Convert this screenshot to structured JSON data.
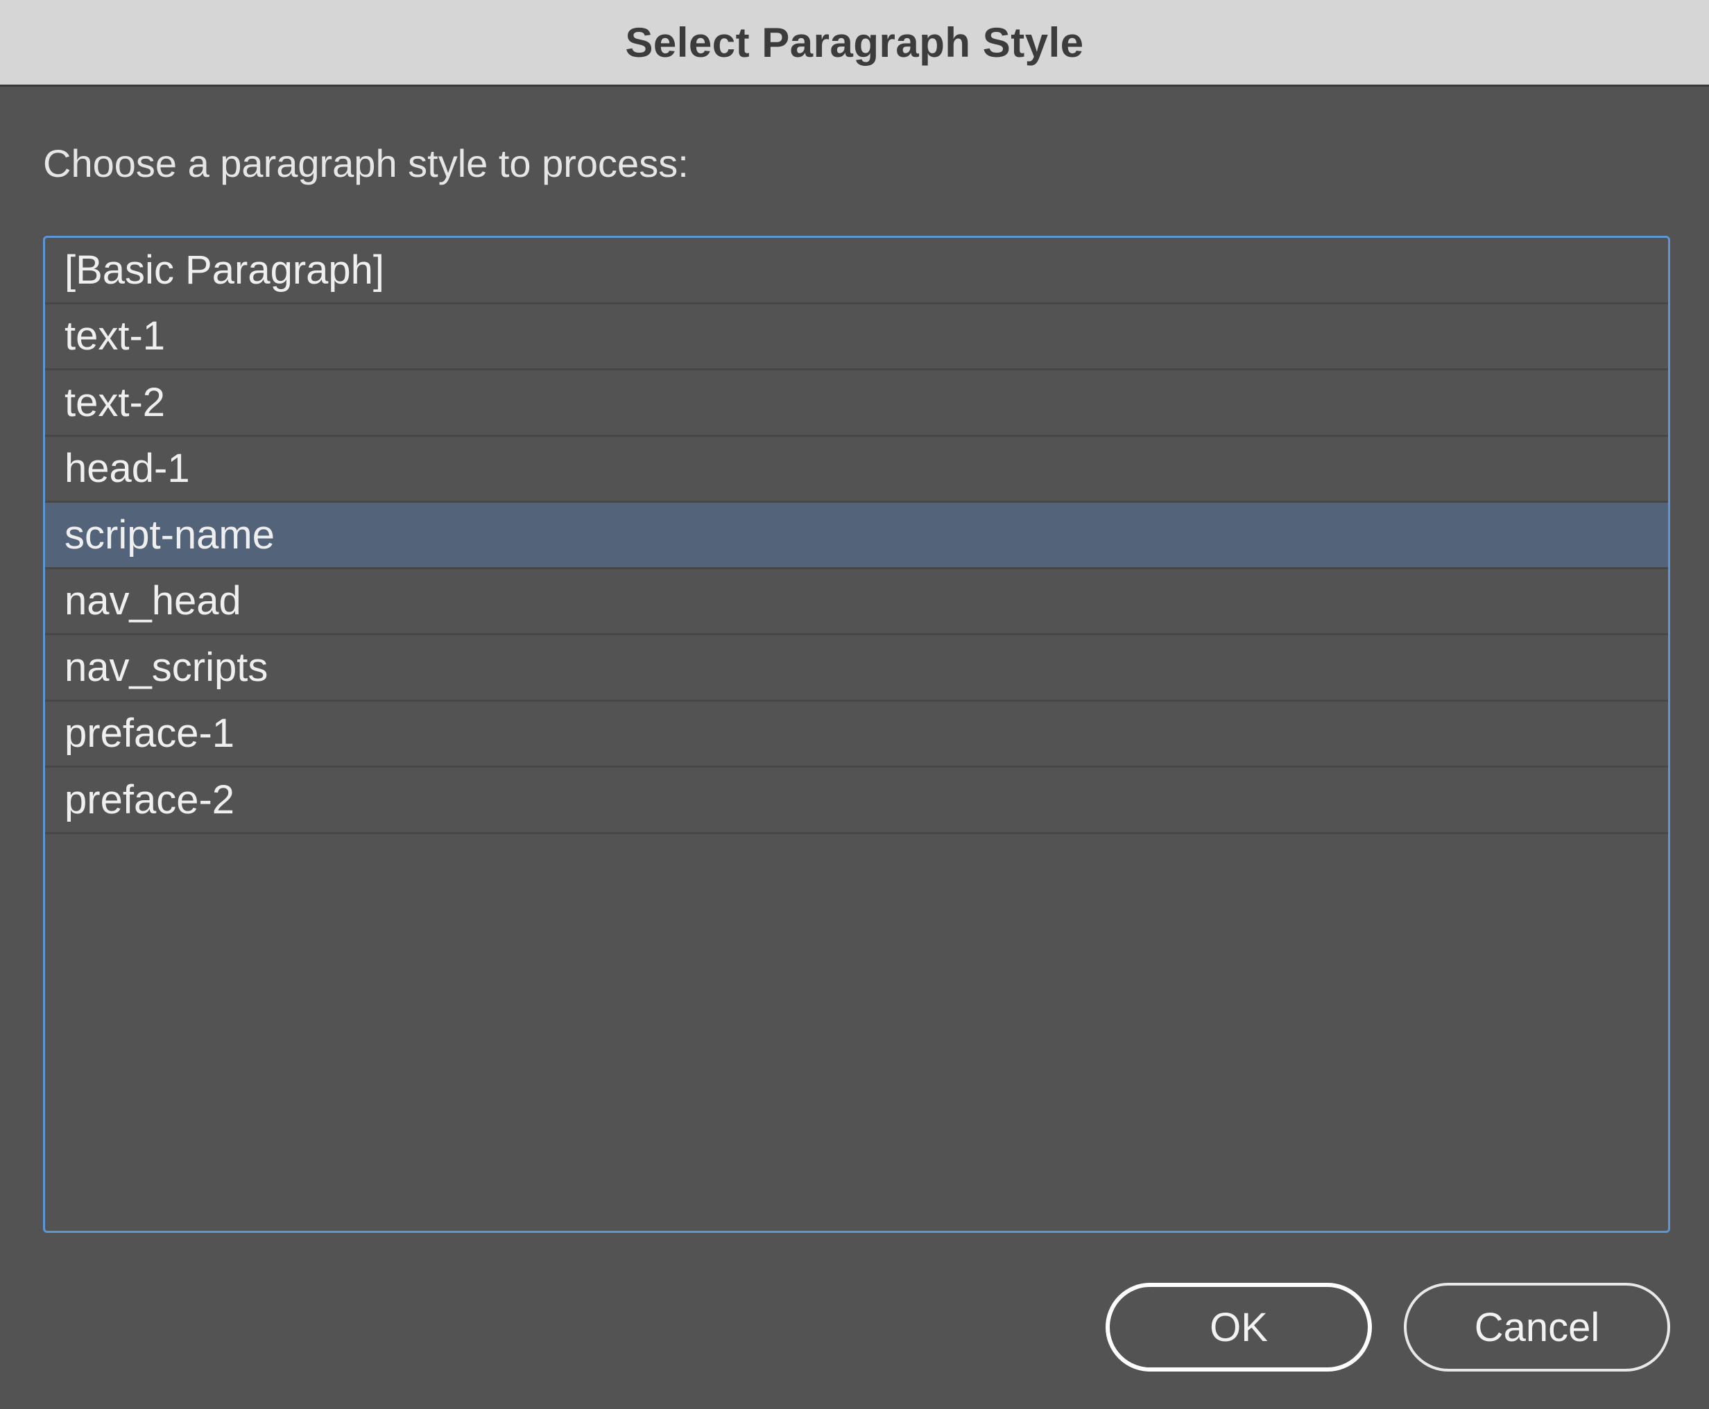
{
  "window": {
    "title": "Select Paragraph Style"
  },
  "prompt": "Choose a paragraph style to process:",
  "list": {
    "items": [
      {
        "label": "[Basic Paragraph]",
        "selected": false
      },
      {
        "label": "text-1",
        "selected": false
      },
      {
        "label": "text-2",
        "selected": false
      },
      {
        "label": "head-1",
        "selected": false
      },
      {
        "label": "script-name",
        "selected": true
      },
      {
        "label": "nav_head",
        "selected": false
      },
      {
        "label": "nav_scripts",
        "selected": false
      },
      {
        "label": "preface-1",
        "selected": false
      },
      {
        "label": "preface-2",
        "selected": false
      }
    ]
  },
  "buttons": {
    "ok_label": "OK",
    "cancel_label": "Cancel"
  },
  "colors": {
    "titlebar": "#d6d6d6",
    "background": "#535353",
    "selection": "#53637a",
    "focus_border": "#5d96d6"
  }
}
